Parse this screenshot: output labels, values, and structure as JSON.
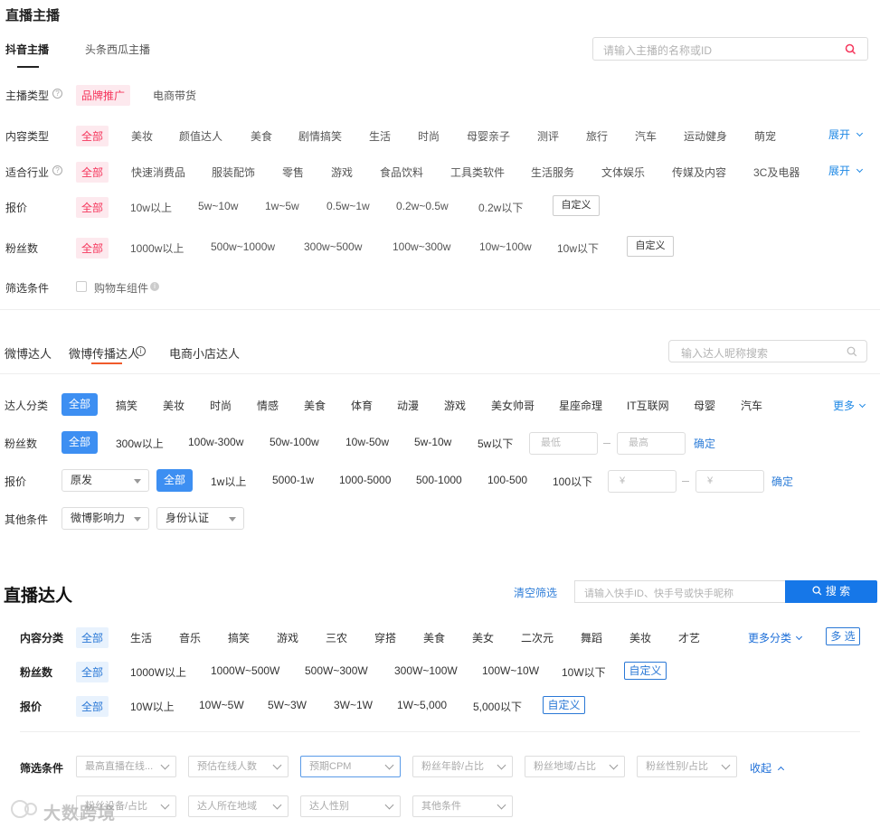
{
  "section1": {
    "title": "直播主播",
    "tabs": [
      "抖音主播",
      "头条西瓜主播"
    ],
    "search_placeholder": "请输入主播的名称或ID",
    "anchor_type": {
      "label": "主播类型",
      "options": [
        "品牌推广",
        "电商带货"
      ]
    },
    "content_type": {
      "label": "内容类型",
      "options": [
        "全部",
        "美妆",
        "颜值达人",
        "美食",
        "剧情搞笑",
        "生活",
        "时尚",
        "母婴亲子",
        "测评",
        "旅行",
        "汽车",
        "运动健身",
        "萌宠"
      ],
      "expand": "展开"
    },
    "industry": {
      "label": "适合行业",
      "options": [
        "全部",
        "快速消费品",
        "服装配饰",
        "零售",
        "游戏",
        "食品饮料",
        "工具类软件",
        "生活服务",
        "文体娱乐",
        "传媒及内容",
        "3C及电器"
      ],
      "expand": "展开"
    },
    "price": {
      "label": "报价",
      "options": [
        "全部",
        "10w以上",
        "5w~10w",
        "1w~5w",
        "0.5w~1w",
        "0.2w~0.5w",
        "0.2w以下"
      ],
      "custom": "自定义"
    },
    "fans": {
      "label": "粉丝数",
      "options": [
        "全部",
        "1000w以上",
        "500w~1000w",
        "300w~500w",
        "100w~300w",
        "10w~100w",
        "10w以下"
      ],
      "custom": "自定义"
    },
    "filter": {
      "label": "筛选条件",
      "checkbox": "购物车组件"
    }
  },
  "section2": {
    "tabs": [
      "微博达人",
      "微博传播达人",
      "电商小店达人"
    ],
    "search_placeholder": "输入达人昵称搜索",
    "category": {
      "label": "达人分类",
      "options": [
        "全部",
        "搞笑",
        "美妆",
        "时尚",
        "情感",
        "美食",
        "体育",
        "动漫",
        "游戏",
        "美女帅哥",
        "星座命理",
        "IT互联网",
        "母婴",
        "汽车"
      ],
      "more": "更多"
    },
    "fans": {
      "label": "粉丝数",
      "options": [
        "全部",
        "300w以上",
        "100w-300w",
        "50w-100w",
        "10w-50w",
        "5w-10w",
        "5w以下"
      ],
      "min_placeholder": "最低",
      "max_placeholder": "最高",
      "confirm": "确定"
    },
    "price": {
      "label": "报价",
      "select": "原发",
      "options": [
        "全部",
        "1w以上",
        "5000-1w",
        "1000-5000",
        "500-1000",
        "100-500",
        "100以下"
      ],
      "yen": "¥",
      "confirm": "确定"
    },
    "other": {
      "label": "其他条件",
      "selects": [
        "微博影响力",
        "身份认证"
      ]
    }
  },
  "section3": {
    "title": "直播达人",
    "clear": "清空筛选",
    "search_placeholder": "请输入快手ID、快手号或快手昵称",
    "search_button": "搜 索",
    "content": {
      "label": "内容分类",
      "options": [
        "全部",
        "生活",
        "音乐",
        "搞笑",
        "游戏",
        "三农",
        "穿搭",
        "美食",
        "美女",
        "二次元",
        "舞蹈",
        "美妆",
        "才艺"
      ],
      "more": "更多分类",
      "multi": "多 选"
    },
    "fans": {
      "label": "粉丝数",
      "options": [
        "全部",
        "1000W以上",
        "1000W~500W",
        "500W~300W",
        "300W~100W",
        "100W~10W",
        "10W以下"
      ],
      "custom": "自定义"
    },
    "price": {
      "label": "报价",
      "options": [
        "全部",
        "10W以上",
        "10W~5W",
        "5W~3W",
        "3W~1W",
        "1W~5,000",
        "5,000以下"
      ],
      "custom": "自定义"
    },
    "filter": {
      "label": "筛选条件",
      "row1": [
        "最高直播在线...",
        "预估在线人数",
        "预期CPM",
        "粉丝年龄/占比",
        "粉丝地域/占比",
        "粉丝性别/占比"
      ],
      "collapse": "收起",
      "row2": [
        "粉丝设备/占比",
        "达人所在地域",
        "达人性别",
        "其他条件"
      ]
    },
    "watermark": "大数跨境"
  },
  "colors": {
    "pink": "#f5365c",
    "blue": "#3d8ff2",
    "link": "#1e88e5"
  }
}
